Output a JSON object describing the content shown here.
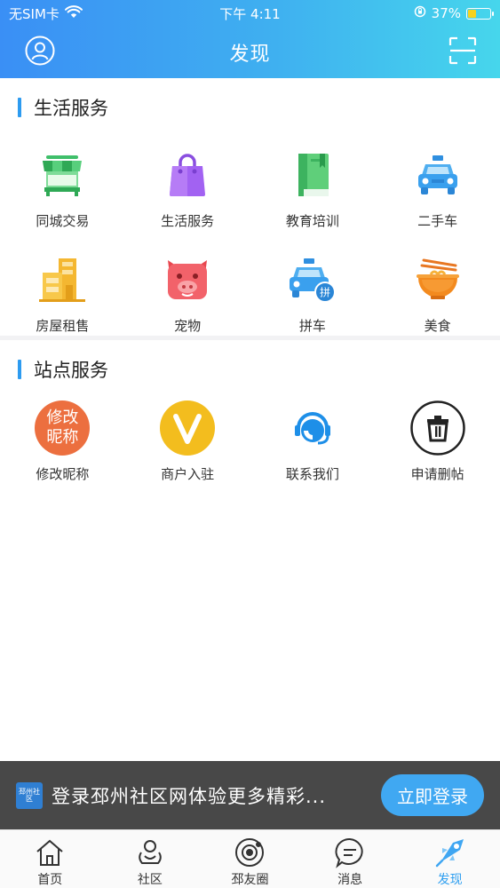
{
  "status_bar": {
    "carrier": "无SIM卡",
    "time": "下午 4:11",
    "battery": "37%",
    "battery_level": 0.37
  },
  "header": {
    "title": "发现"
  },
  "sections": [
    {
      "title": "生活服务",
      "items": [
        {
          "label": "同城交易",
          "icon": "market-stall-icon"
        },
        {
          "label": "生活服务",
          "icon": "shopping-bag-icon"
        },
        {
          "label": "教育培训",
          "icon": "book-icon"
        },
        {
          "label": "二手车",
          "icon": "car-icon"
        },
        {
          "label": "房屋租售",
          "icon": "building-icon"
        },
        {
          "label": "宠物",
          "icon": "pig-icon"
        },
        {
          "label": "拼车",
          "icon": "carpool-icon"
        },
        {
          "label": "美食",
          "icon": "noodle-bowl-icon"
        }
      ]
    },
    {
      "title": "站点服务",
      "items": [
        {
          "label": "修改昵称",
          "icon": "edit-nickname-icon",
          "badge_text": "修改\n昵称"
        },
        {
          "label": "商户入驻",
          "icon": "merchant-v-icon"
        },
        {
          "label": "联系我们",
          "icon": "headset-icon"
        },
        {
          "label": "申请删帖",
          "icon": "trash-icon"
        }
      ]
    }
  ],
  "carpool_badge": "拼",
  "login_banner": {
    "text": "登录邳州社区网体验更多精彩...",
    "button": "立即登录",
    "logo_text": "邳州社区"
  },
  "tabbar": [
    {
      "label": "首页",
      "icon": "home-icon",
      "active": false
    },
    {
      "label": "社区",
      "icon": "community-icon",
      "active": false
    },
    {
      "label": "邳友圈",
      "icon": "planet-icon",
      "active": false
    },
    {
      "label": "消息",
      "icon": "message-icon",
      "active": false
    },
    {
      "label": "发现",
      "icon": "discover-icon",
      "active": true
    }
  ],
  "colors": {
    "header_start": "#3a8ff5",
    "header_end": "#46d6ec",
    "accent": "#2f9ff0",
    "banner_bg": "#484848"
  }
}
